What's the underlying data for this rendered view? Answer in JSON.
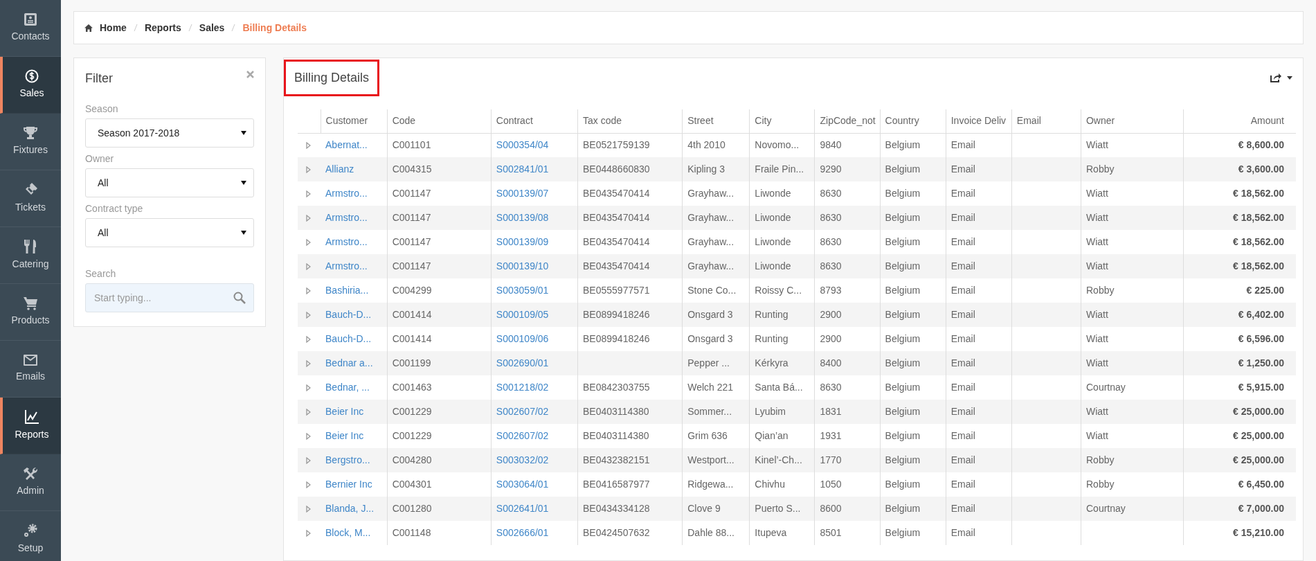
{
  "sidebar": {
    "items": [
      {
        "label": "Contacts",
        "selected": false
      },
      {
        "label": "Sales",
        "selected": true
      },
      {
        "label": "Fixtures",
        "selected": false
      },
      {
        "label": "Tickets",
        "selected": false
      },
      {
        "label": "Catering",
        "selected": false
      },
      {
        "label": "Products",
        "selected": false
      },
      {
        "label": "Emails",
        "selected": false
      },
      {
        "label": "Reports",
        "selected": true
      },
      {
        "label": "Admin",
        "selected": false
      },
      {
        "label": "Setup",
        "selected": false
      }
    ]
  },
  "breadcrumb": [
    {
      "label": "Home",
      "current": false
    },
    {
      "label": "Reports",
      "current": false
    },
    {
      "label": "Sales",
      "current": false
    },
    {
      "label": "Billing Details",
      "current": true
    }
  ],
  "filter": {
    "title": "Filter",
    "fields": [
      {
        "kind": "select",
        "label": "Season",
        "value": "Season 2017-2018"
      },
      {
        "kind": "select",
        "label": "Owner",
        "value": "All"
      },
      {
        "kind": "select",
        "label": "Contract type",
        "value": "All"
      },
      {
        "kind": "search",
        "label": "Search",
        "placeholder": "Start typing..."
      }
    ]
  },
  "report": {
    "title": "Billing Details",
    "columns": [
      "Customer",
      "Code",
      "Contract",
      "Tax code",
      "Street",
      "City",
      "ZipCode_not",
      "Country",
      "Invoice Deliv",
      "Email",
      "Owner",
      "Amount"
    ],
    "rows": [
      {
        "expanded": false,
        "customer": "Abernat...",
        "code": "C001101",
        "contract": "S000354/04",
        "tax_code": "BE0521759139",
        "street": "4th 2010",
        "city": "Novomo...",
        "zip": "9840",
        "country": "Belgium",
        "invoice": "Email",
        "owner": "Wiatt",
        "amount": "€ 8,600.00"
      },
      {
        "expanded": false,
        "customer": "Allianz",
        "code": "C004315",
        "contract": "S002841/01",
        "tax_code": "BE0448660830",
        "street": "Kipling 3",
        "city": "Fraile Pin...",
        "zip": "9290",
        "country": "Belgium",
        "invoice": "Email",
        "owner": "Robby",
        "amount": "€ 3,600.00"
      },
      {
        "expanded": false,
        "customer": "Armstro...",
        "code": "C001147",
        "contract": "S000139/07",
        "tax_code": "BE0435470414",
        "street": "Grayhaw...",
        "city": "Liwonde",
        "zip": "8630",
        "country": "Belgium",
        "invoice": "Email",
        "owner": "Wiatt",
        "amount": "€ 18,562.00"
      },
      {
        "expanded": false,
        "customer": "Armstro...",
        "code": "C001147",
        "contract": "S000139/08",
        "tax_code": "BE0435470414",
        "street": "Grayhaw...",
        "city": "Liwonde",
        "zip": "8630",
        "country": "Belgium",
        "invoice": "Email",
        "owner": "Wiatt",
        "amount": "€ 18,562.00"
      },
      {
        "expanded": false,
        "customer": "Armstro...",
        "code": "C001147",
        "contract": "S000139/09",
        "tax_code": "BE0435470414",
        "street": "Grayhaw...",
        "city": "Liwonde",
        "zip": "8630",
        "country": "Belgium",
        "invoice": "Email",
        "owner": "Wiatt",
        "amount": "€ 18,562.00"
      },
      {
        "expanded": false,
        "customer": "Armstro...",
        "code": "C001147",
        "contract": "S000139/10",
        "tax_code": "BE0435470414",
        "street": "Grayhaw...",
        "city": "Liwonde",
        "zip": "8630",
        "country": "Belgium",
        "invoice": "Email",
        "owner": "Wiatt",
        "amount": "€ 18,562.00"
      },
      {
        "expanded": false,
        "customer": "Bashiria...",
        "code": "C004299",
        "contract": "S003059/01",
        "tax_code": "BE0555977571",
        "street": "Stone Co...",
        "city": "Roissy C...",
        "zip": "8793",
        "country": "Belgium",
        "invoice": "Email",
        "owner": "Robby",
        "amount": "€ 225.00"
      },
      {
        "expanded": false,
        "customer": "Bauch-D...",
        "code": "C001414",
        "contract": "S000109/05",
        "tax_code": "BE0899418246",
        "street": "Onsgard 3",
        "city": "Runting",
        "zip": "2900",
        "country": "Belgium",
        "invoice": "Email",
        "owner": "Wiatt",
        "amount": "€ 6,402.00"
      },
      {
        "expanded": false,
        "customer": "Bauch-D...",
        "code": "C001414",
        "contract": "S000109/06",
        "tax_code": "BE0899418246",
        "street": "Onsgard 3",
        "city": "Runting",
        "zip": "2900",
        "country": "Belgium",
        "invoice": "Email",
        "owner": "Wiatt",
        "amount": "€ 6,596.00"
      },
      {
        "expanded": false,
        "customer": "Bednar a...",
        "code": "C001199",
        "contract": "S002690/01",
        "street": "Pepper ...",
        "city": "Kérkyra",
        "zip": "8400",
        "country": "Belgium",
        "invoice": "Email",
        "owner": "Wiatt",
        "amount": "€ 1,250.00"
      },
      {
        "expanded": false,
        "customer": "Bednar, ...",
        "code": "C001463",
        "contract": "S001218/02",
        "tax_code": "BE0842303755",
        "street": "Welch 221",
        "city": "Santa Bá...",
        "zip": "8630",
        "country": "Belgium",
        "invoice": "Email",
        "owner": "Courtnay",
        "amount": "€ 5,915.00"
      },
      {
        "expanded": false,
        "customer": "Beier Inc",
        "code": "C001229",
        "contract": "S002607/02",
        "tax_code": "BE0403114380",
        "street": "Sommer...",
        "city": "Lyubim",
        "zip": "1831",
        "country": "Belgium",
        "invoice": "Email",
        "owner": "Wiatt",
        "amount": "€ 25,000.00"
      },
      {
        "expanded": false,
        "customer": "Beier Inc",
        "code": "C001229",
        "contract": "S002607/02",
        "tax_code": "BE0403114380",
        "street": "Grim 636",
        "city": "Qian’an",
        "zip": "1931",
        "country": "Belgium",
        "invoice": "Email",
        "owner": "Wiatt",
        "amount": "€ 25,000.00"
      },
      {
        "expanded": false,
        "customer": "Bergstro...",
        "code": "C004280",
        "contract": "S003032/02",
        "tax_code": "BE0432382151",
        "street": "Westport...",
        "city": "Kinel’-Ch...",
        "zip": "1770",
        "country": "Belgium",
        "invoice": "Email",
        "owner": "Robby",
        "amount": "€ 25,000.00"
      },
      {
        "expanded": false,
        "customer": "Bernier Inc",
        "code": "C004301",
        "contract": "S003064/01",
        "tax_code": "BE0416587977",
        "street": "Ridgewa...",
        "city": "Chivhu",
        "zip": "1050",
        "country": "Belgium",
        "invoice": "Email",
        "owner": "Robby",
        "amount": "€ 6,450.00"
      },
      {
        "expanded": false,
        "customer": "Blanda, J...",
        "code": "C001280",
        "contract": "S002641/01",
        "tax_code": "BE0434334128",
        "street": "Clove 9",
        "city": "Puerto S...",
        "zip": "8600",
        "country": "Belgium",
        "invoice": "Email",
        "owner": "Courtnay",
        "amount": "€ 7,000.00"
      },
      {
        "expanded": false,
        "customer": "Block, M...",
        "code": "C001148",
        "contract": "S002666/01",
        "tax_code": "BE0424507632",
        "street": "Dahle 88...",
        "city": "Itupeva",
        "zip": "8501",
        "country": "Belgium",
        "invoice": "Email",
        "amount": "€ 15,210.00"
      }
    ]
  }
}
